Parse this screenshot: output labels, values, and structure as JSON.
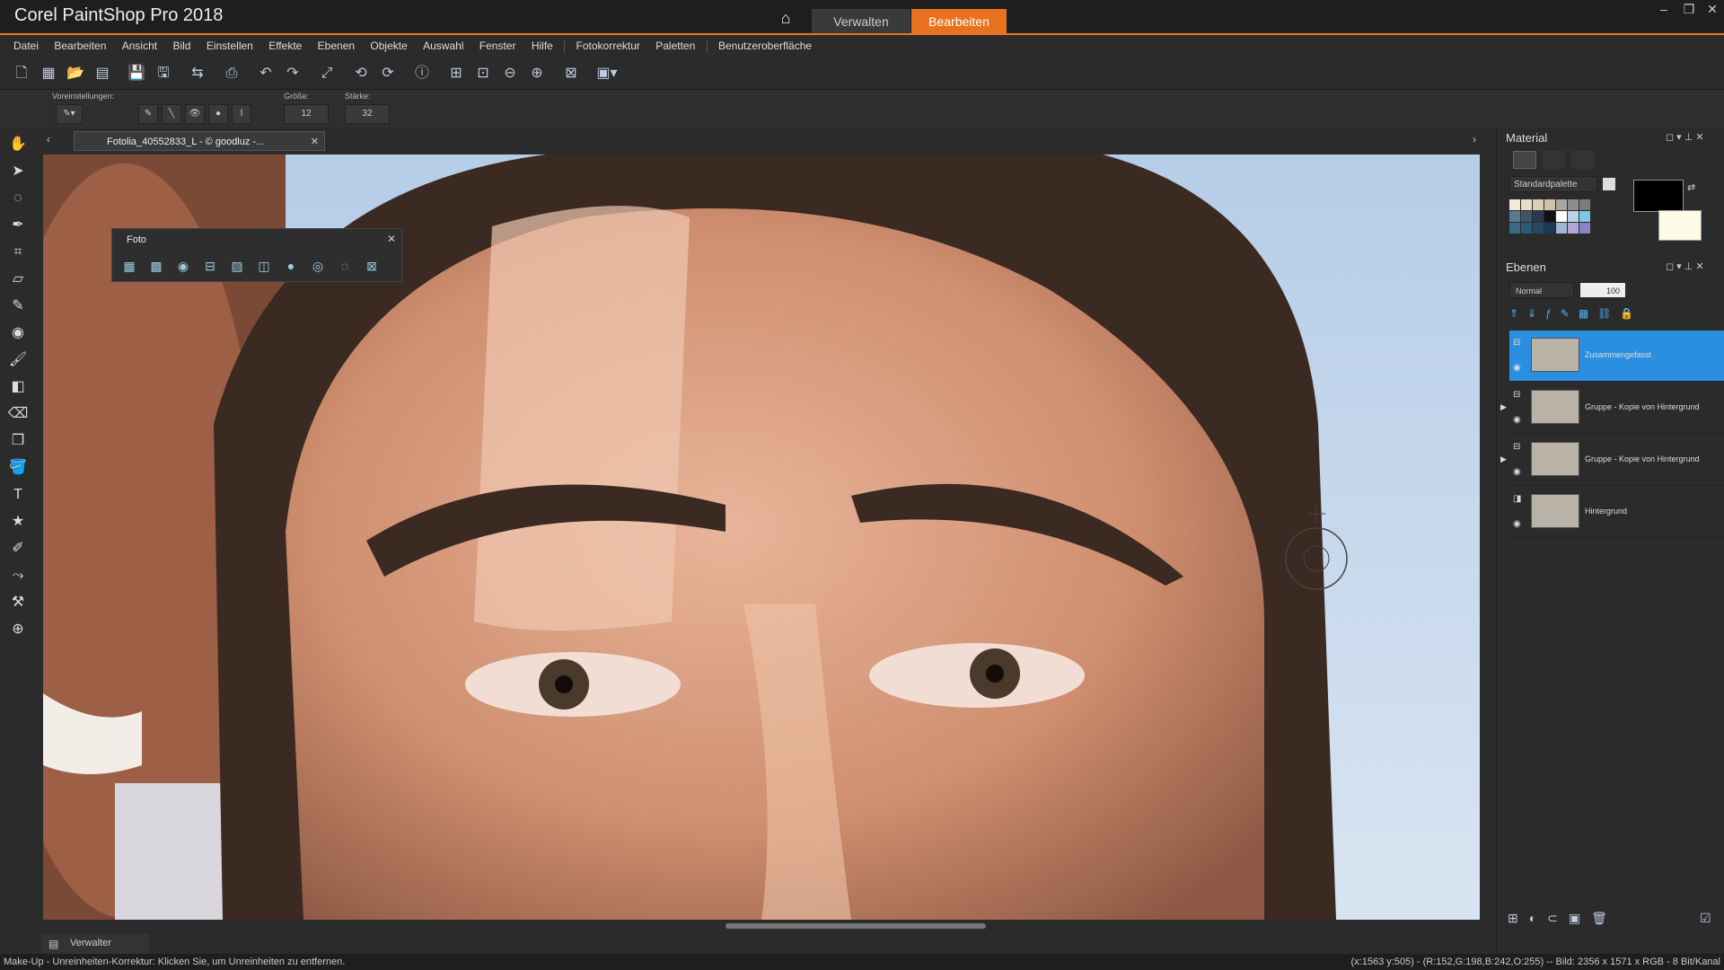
{
  "app": {
    "title": "Corel PaintShop Pro 2018",
    "home_icon": "home-icon"
  },
  "workspace_tabs": {
    "manage": "Verwalten",
    "edit": "Bearbeiten",
    "active": "edit"
  },
  "window_controls": [
    "minimize-icon",
    "restore-icon",
    "close-icon"
  ],
  "menu": [
    "Datei",
    "Bearbeiten",
    "Ansicht",
    "Bild",
    "Einstellen",
    "Effekte",
    "Ebenen",
    "Objekte",
    "Auswahl",
    "Fenster",
    "Hilfe",
    "Fotokorrektur",
    "Paletten",
    "Benutzeroberfläche"
  ],
  "options": {
    "presets_label": "Voreinstellungen:",
    "size_label": "Größe:",
    "size_value": "12",
    "strength_label": "Stärke:",
    "strength_value": "32"
  },
  "document": {
    "tab_title": "Fotolia_40552833_L - © goodluz -..."
  },
  "foto_palette": {
    "title": "Foto"
  },
  "material": {
    "title": "Material",
    "palette_select": "Standardpalette",
    "foreground_color": "#000000",
    "background_color": "#fffbe6"
  },
  "layers": {
    "title": "Ebenen",
    "blend_mode": "Normal",
    "opacity": "100",
    "items": [
      {
        "name": "Zusammengefasst",
        "selected": true
      },
      {
        "name": "Gruppe - Kopie von Hintergrund",
        "selected": false
      },
      {
        "name": "Gruppe - Kopie von Hintergrund",
        "selected": false
      },
      {
        "name": "Hintergrund",
        "selected": false
      }
    ]
  },
  "bottom_tab": {
    "label": "Verwalter"
  },
  "status": {
    "left": "Make-Up - Unreinheiten-Korrektur: Klicken Sie, um Unreinheiten zu entfernen.",
    "right": "(x:1563 y:505) - (R:152,G:198,B:242,O:255) -- Bild:  2356 x 1571 x RGB - 8 Bit/Kanal"
  }
}
